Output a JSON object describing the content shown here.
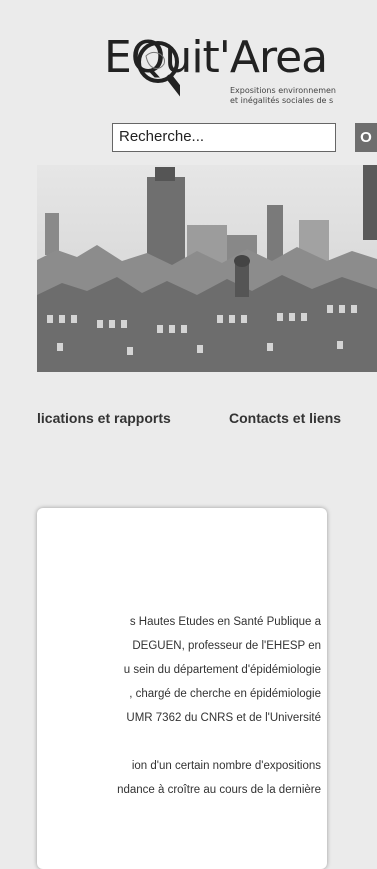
{
  "logo": {
    "wordmark": "EQuit'Area",
    "subtitle_line1": "Expositions environnemen",
    "subtitle_line2": "et inégalités sociales de s"
  },
  "search": {
    "placeholder": "Recherche...",
    "button_label": "O"
  },
  "nav": {
    "items": [
      "lications et rapports",
      "Contacts et liens"
    ]
  },
  "content": {
    "paragraph1_lines": [
      "s Hautes Etudes en Santé Publique a",
      "DEGUEN, professeur de l'EHESP en",
      "u sein du département d'épidémiologie",
      ", chargé de cherche en épidémiologie",
      "UMR 7362 du CNRS et de l'Université"
    ],
    "paragraph2_lines": [
      "ion d'un certain nombre d'expositions",
      "ndance à croître au cours de la dernière"
    ]
  },
  "colors": {
    "background": "#ebebeb",
    "search_button": "#6e6e6e",
    "text": "#333333"
  }
}
